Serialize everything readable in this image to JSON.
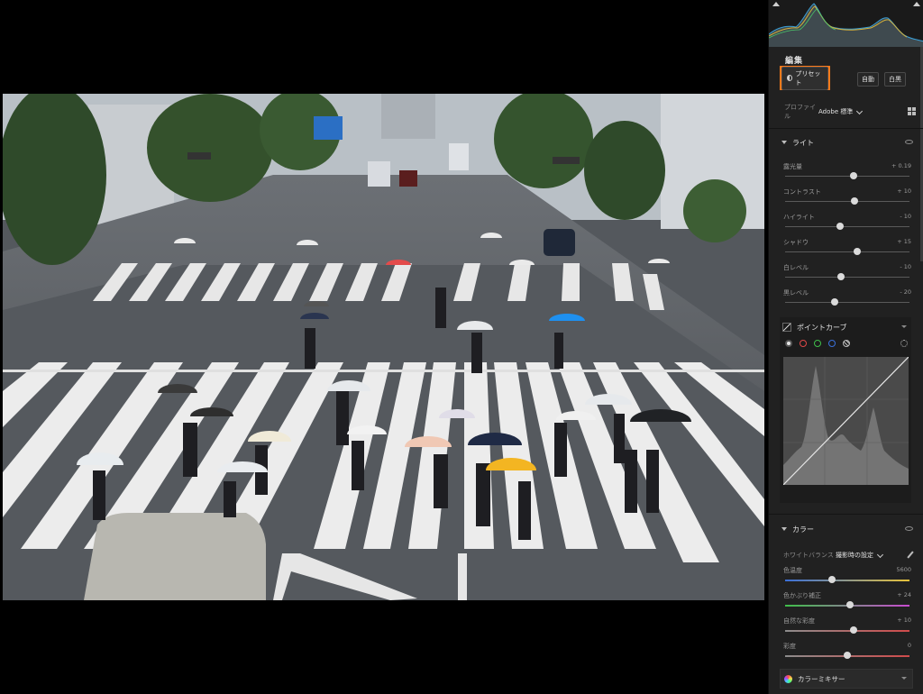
{
  "panel": {
    "edit_title": "編集",
    "preset_label": "プリセット",
    "auto_label": "自動",
    "bw_label": "白黒",
    "profile_label": "プロファイル",
    "profile_value": "Adobe 標準"
  },
  "light": {
    "title": "ライト",
    "sliders": [
      {
        "label": "露光量",
        "value": "+ 0.19",
        "level": 0.55
      },
      {
        "label": "コントラスト",
        "value": "+ 10",
        "level": 0.56
      },
      {
        "label": "ハイライト",
        "value": "- 10",
        "level": 0.44
      },
      {
        "label": "シャドウ",
        "value": "+ 15",
        "level": 0.58
      },
      {
        "label": "白レベル",
        "value": "- 10",
        "level": 0.45
      },
      {
        "label": "黒レベル",
        "value": "- 20",
        "level": 0.4
      }
    ]
  },
  "curve": {
    "title": "ポイントカーブ"
  },
  "color": {
    "title": "カラー",
    "wb_label": "ホワイトバランス",
    "wb_value": "撮影時の設定",
    "sliders": [
      {
        "label": "色温度",
        "value": "5600",
        "level": 0.38,
        "gradient": "linear-gradient(90deg,#3a6fd8,#e6c23a)"
      },
      {
        "label": "色かぶり補正",
        "value": "+ 24",
        "level": 0.52,
        "gradient": "linear-gradient(90deg,#3fbf4a,#c84bd0)"
      },
      {
        "label": "自然な彩度",
        "value": "+ 10",
        "level": 0.55,
        "gradient": "linear-gradient(90deg,#8c8c8c,#d04b4b)"
      },
      {
        "label": "彩度",
        "value": "0",
        "level": 0.5,
        "gradient": "linear-gradient(90deg,#8c8c8c,#d04b4b)"
      }
    ]
  },
  "mixer": {
    "title": "カラーミキサー"
  },
  "colors": {
    "accent_highlight": "#ff7a1a",
    "panel_bg": "#212121"
  }
}
